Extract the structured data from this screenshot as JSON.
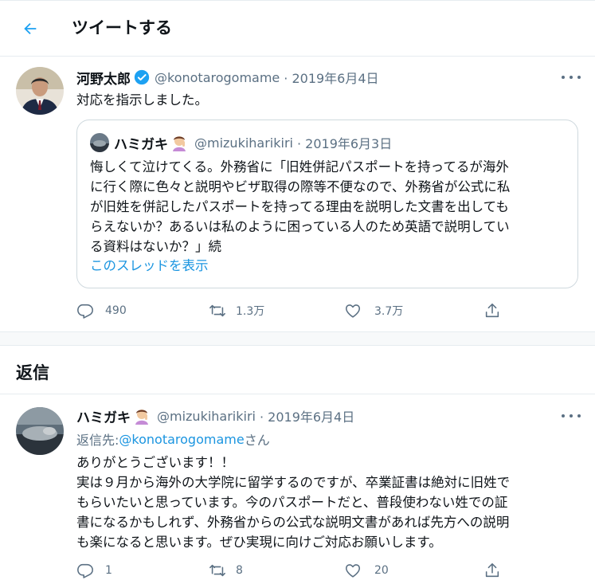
{
  "header": {
    "title": "ツイートする"
  },
  "main_tweet": {
    "name": "河野太郎",
    "handle": "@konotarogomame",
    "date": "· 2019年6月4日",
    "text": "対応を指示しました。",
    "quote": {
      "name": "ハミガキ",
      "handle": "@mizukiharikiri",
      "date": "· 2019年6月3日",
      "lines": [
        "悔しくて泣けてくる。外務省に「旧姓併記パスポートを持ってるが海外",
        "に行く際に色々と説明やビザ取得の際等不便なので、外務省が公式に私",
        "が旧姓を併記したパスポートを持ってる理由を説明した文書を出しても",
        "らえないか？あるいは私のように困っている人のため英語で説明してい",
        "る資料はないか？」続"
      ],
      "thread_link": "このスレッドを表示"
    },
    "stats": {
      "replies": "490",
      "retweets": "1.3万",
      "likes": "3.7万"
    }
  },
  "replies_section": {
    "title": "返信"
  },
  "reply": {
    "name": "ハミガキ",
    "handle": "@mizukiharikiri",
    "date": "· 2019年6月4日",
    "replying_to_prefix": "返信先: ",
    "replying_to_handle": "@konotarogomame",
    "replying_to_suffix": "さん",
    "lines": [
      "ありがとうございます！！",
      "実は９月から海外の大学院に留学するのですが、卒業証書は絶対に旧姓で",
      "もらいたいと思っています。今のパスポートだと、普段使わない姓での証",
      "書になるかもしれず、外務省からの公式な説明文書があれば先方への説明",
      "も楽になると思います。ぜひ実現に向けご対応お願いします。"
    ],
    "stats": {
      "replies": "1",
      "retweets": "8",
      "likes": "20"
    }
  },
  "colors": {
    "accent": "#1da1f2",
    "text": "#0f1419",
    "muted": "#5b7083",
    "border": "#e6ecf0"
  }
}
